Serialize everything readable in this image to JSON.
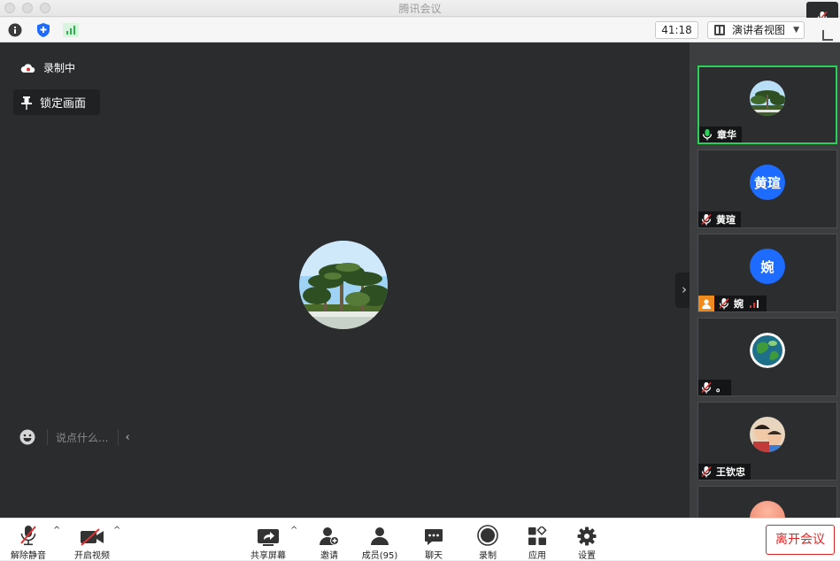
{
  "window": {
    "title": "腾讯会议"
  },
  "infobar": {
    "timer": "41:18",
    "view_mode": "演讲者视图"
  },
  "stage": {
    "recording_label": "录制中",
    "lock_label": "锁定画面",
    "chat_placeholder": "说点什么..."
  },
  "participants": [
    {
      "name": "章华",
      "mic": "on",
      "active": true,
      "avatar": "photo-palms"
    },
    {
      "name": "黄瑄",
      "mic": "muted",
      "avatar_text": "黄瑄",
      "avatar_color": "#1e6bff"
    },
    {
      "name": "婉",
      "mic": "muted",
      "avatar_text": "婉",
      "avatar_color": "#1e6bff",
      "host": true,
      "signal": true
    },
    {
      "name": "。",
      "mic": "muted",
      "avatar": "photo-earth"
    },
    {
      "name": "王钦忠",
      "mic": "muted",
      "avatar": "photo-child"
    }
  ],
  "toolbar": {
    "unmute": "解除静音",
    "start_video": "开启视频",
    "share": "共享屏幕",
    "invite": "邀请",
    "members": "成员(95)",
    "chat": "聊天",
    "record": "录制",
    "apps": "应用",
    "settings": "设置",
    "leave": "离开会议"
  },
  "colors": {
    "active_border": "#2bd157",
    "leave_red": "#e02323",
    "avatar_blue": "#1e6bff",
    "stage_bg": "#2a2c2e"
  }
}
